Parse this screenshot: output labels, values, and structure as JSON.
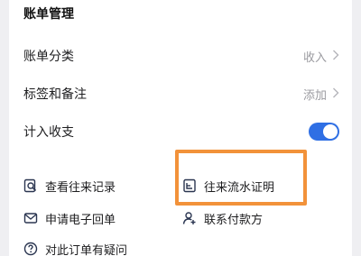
{
  "section": {
    "title": "账单管理"
  },
  "settings": [
    {
      "label": "账单分类",
      "value": "收入"
    },
    {
      "label": "标签和备注",
      "value": "添加"
    }
  ],
  "toggle_row": {
    "label": "计入收支",
    "state": "on"
  },
  "actions": {
    "view_records": "查看往来记录",
    "transfer_proof": "往来流水证明",
    "apply_receipt": "申请电子回单",
    "contact_payer": "联系付款方",
    "order_question": "对此订单有疑问"
  },
  "colors": {
    "accent": "#2f6fe4",
    "highlight": "#f2923a"
  }
}
